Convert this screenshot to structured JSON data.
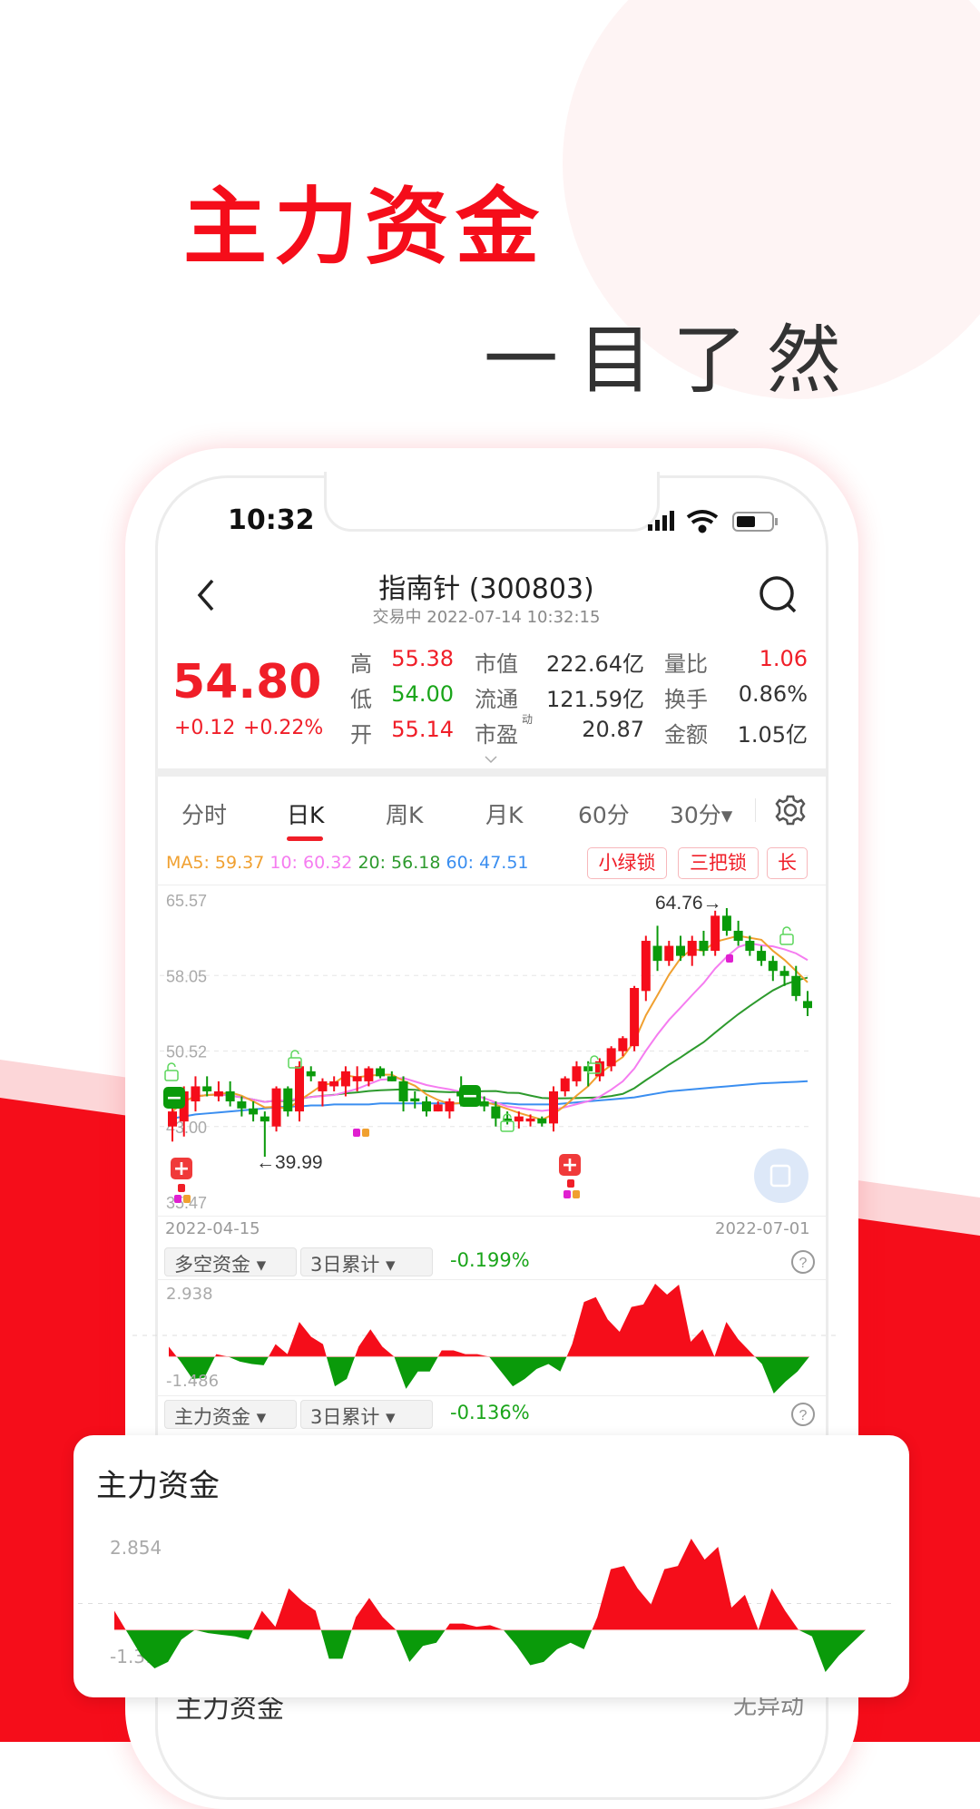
{
  "hero": {
    "title": "主力资金",
    "subtitle": "一目了然"
  },
  "colors": {
    "brand_red": "#f50d1a",
    "up": "#f50d1a",
    "down": "#0a9a0a",
    "ma5": "#f0a030",
    "ma10": "#f57cf0",
    "ma20": "#2d9a2d",
    "ma60": "#3a8ef0"
  },
  "status_bar": {
    "time": "10:32",
    "icons": [
      "signal-icon",
      "wifi-icon",
      "battery-icon"
    ]
  },
  "header": {
    "title": "指南针 (300803)",
    "subtitle": "交易中 2022-07-14 10:32:15"
  },
  "quote": {
    "price": "54.80",
    "change": "+0.12",
    "change_pct": "+0.22%",
    "stats": [
      [
        {
          "label": "高",
          "value": "55.38",
          "tone": "red"
        },
        {
          "label": "市值",
          "value": "222.64亿"
        },
        {
          "label": "量比",
          "value": "1.06",
          "tone": "red"
        }
      ],
      [
        {
          "label": "低",
          "value": "54.00",
          "tone": "green"
        },
        {
          "label": "流通",
          "value": "121.59亿"
        },
        {
          "label": "换手",
          "value": "0.86%"
        }
      ],
      [
        {
          "label": "开",
          "value": "55.14",
          "tone": "red"
        },
        {
          "label": "市盈",
          "sup": "动",
          "value": "20.87"
        },
        {
          "label": "金额",
          "value": "1.05亿"
        }
      ]
    ]
  },
  "tabs": [
    {
      "label": "分时"
    },
    {
      "label": "日K",
      "active": true
    },
    {
      "label": "周K"
    },
    {
      "label": "月K"
    },
    {
      "label": "60分"
    },
    {
      "label": "30分▾"
    }
  ],
  "ma": {
    "ma5": "MA5: 59.37",
    "ma10": "10: 60.32",
    "ma20": "20: 56.18",
    "ma60": "60: 47.51"
  },
  "tags": [
    "小绿锁",
    "三把锁",
    "长"
  ],
  "chart_data": [
    {
      "type": "candlestick",
      "y_ticks": [
        "65.57",
        "58.05",
        "50.52",
        "43.00",
        "35.47"
      ],
      "ylim": [
        35.47,
        65.57
      ],
      "x_labels": [
        "2022-04-15",
        "2022-07-01"
      ],
      "annotations": {
        "high": "64.76→",
        "low": "←39.99"
      },
      "ohlc": [
        [
          43.0,
          45.0,
          41.5,
          44.5
        ],
        [
          43.5,
          47.0,
          42.0,
          46.5
        ],
        [
          45.5,
          48.0,
          44.5,
          47.0
        ],
        [
          47.0,
          48.0,
          46.0,
          46.5
        ],
        [
          46.0,
          47.5,
          45.5,
          46.5
        ],
        [
          46.5,
          47.5,
          45.0,
          45.5
        ],
        [
          45.5,
          46.0,
          44.0,
          44.8
        ],
        [
          44.8,
          45.5,
          43.5,
          44.2
        ],
        [
          44.0,
          44.5,
          39.99,
          43.5
        ],
        [
          43.0,
          47.0,
          42.5,
          46.8
        ],
        [
          46.8,
          47.0,
          44.0,
          44.5
        ],
        [
          44.5,
          49.5,
          43.5,
          49.0
        ],
        [
          48.5,
          49.0,
          47.5,
          48.0
        ],
        [
          46.5,
          47.8,
          45.0,
          47.5
        ],
        [
          47.0,
          48.0,
          46.5,
          47.5
        ],
        [
          47.0,
          49.0,
          46.0,
          48.5
        ],
        [
          47.5,
          49.0,
          46.5,
          48.0
        ],
        [
          47.5,
          49.0,
          47.0,
          48.8
        ],
        [
          48.8,
          49.0,
          47.8,
          48.0
        ],
        [
          48.0,
          48.5,
          47.5,
          47.5
        ],
        [
          47.5,
          48.0,
          44.5,
          45.5
        ],
        [
          45.8,
          46.5,
          44.8,
          45.5
        ],
        [
          45.5,
          46.0,
          44.0,
          44.5
        ],
        [
          44.5,
          45.5,
          44.5,
          45.2
        ],
        [
          44.5,
          45.8,
          43.8,
          45.5
        ],
        [
          46.5,
          48.0,
          45.0,
          46.0
        ],
        [
          46.0,
          46.5,
          45.0,
          45.5
        ],
        [
          45.5,
          46.0,
          44.5,
          45.0
        ],
        [
          45.0,
          45.5,
          43.0,
          43.8
        ],
        [
          43.8,
          44.5,
          43.2,
          43.5
        ],
        [
          43.5,
          44.5,
          42.8,
          44.0
        ],
        [
          43.5,
          44.2,
          43.0,
          43.8
        ],
        [
          43.8,
          44.0,
          43.0,
          43.3
        ],
        [
          43.3,
          47.0,
          42.5,
          46.5
        ],
        [
          46.5,
          48.0,
          46.0,
          47.8
        ],
        [
          47.5,
          49.5,
          47.0,
          49.0
        ],
        [
          49.0,
          49.5,
          47.0,
          48.5
        ],
        [
          48.0,
          49.8,
          47.5,
          49.5
        ],
        [
          49.0,
          51.0,
          48.5,
          50.8
        ],
        [
          50.5,
          52.0,
          50.0,
          51.8
        ],
        [
          51.0,
          57.0,
          50.5,
          56.8
        ],
        [
          56.5,
          62.0,
          55.5,
          61.5
        ],
        [
          61.0,
          63.0,
          58.5,
          59.5
        ],
        [
          59.5,
          61.5,
          59.0,
          61.0
        ],
        [
          61.0,
          62.0,
          59.5,
          60.0
        ],
        [
          60.0,
          62.0,
          59.0,
          61.5
        ],
        [
          61.5,
          62.5,
          60.0,
          60.5
        ],
        [
          60.5,
          64.5,
          60.0,
          64.0
        ],
        [
          64.0,
          64.76,
          62.0,
          62.5
        ],
        [
          62.5,
          63.5,
          61.0,
          61.5
        ],
        [
          61.5,
          62.0,
          60.0,
          60.5
        ],
        [
          60.5,
          61.0,
          59.0,
          59.5
        ],
        [
          59.5,
          60.0,
          57.5,
          58.5
        ],
        [
          58.5,
          59.0,
          57.0,
          58.0
        ],
        [
          58.0,
          59.0,
          55.5,
          56.0
        ],
        [
          55.5,
          56.5,
          54.0,
          54.8
        ]
      ],
      "ma60": [
        43.8,
        44.0,
        44.2,
        44.3,
        44.4,
        44.5,
        44.6,
        44.7,
        44.8,
        44.9,
        45.0,
        45.0,
        45.1,
        45.1,
        45.2,
        45.2,
        45.2,
        45.2,
        45.3,
        45.3,
        45.3,
        45.3,
        45.3,
        45.3,
        45.3,
        45.3,
        45.3,
        45.3,
        45.3,
        45.3,
        45.2,
        45.2,
        45.2,
        45.2,
        45.3,
        45.4,
        45.5,
        45.6,
        45.7,
        45.8,
        45.9,
        46.1,
        46.3,
        46.5,
        46.6,
        46.7,
        46.8,
        46.9,
        47.0,
        47.1,
        47.2,
        47.3,
        47.35,
        47.4,
        47.45,
        47.51
      ]
    },
    {
      "type": "area",
      "indicator": "多空资金",
      "period": "3日累计",
      "value": "-0.199%",
      "y_ticks": [
        "2.938",
        "-1.486"
      ],
      "ylim": [
        -1.486,
        2.938
      ],
      "values": [
        0.4,
        -0.2,
        -0.9,
        -0.85,
        0.1,
        0,
        -0.2,
        -0.3,
        -0.35,
        0.5,
        0.1,
        1.4,
        0.8,
        0.5,
        -1.2,
        -0.9,
        0.4,
        1.1,
        0.4,
        0,
        -1.3,
        -0.6,
        -0.6,
        0.25,
        0.25,
        0.1,
        0.1,
        0,
        -0.6,
        -1.2,
        -0.9,
        -0.5,
        -0.3,
        -0.6,
        0.5,
        2.2,
        2.4,
        1.5,
        1.0,
        2.0,
        2.1,
        2.938,
        2.5,
        2.9,
        0.6,
        1.1,
        0,
        1.4,
        0.7,
        0.2,
        -0.3,
        -1.486,
        -1.0,
        -0.6,
        0
      ]
    },
    {
      "type": "area",
      "indicator": "主力资金",
      "period": "3日累计",
      "value": "-0.136%"
    },
    {
      "type": "area",
      "title": "主力资金",
      "y_ticks": [
        "2.854",
        "-1.314"
      ],
      "ylim": [
        -1.314,
        2.854
      ],
      "values": [
        0.6,
        -0.1,
        -0.8,
        -1.2,
        -1.0,
        -0.3,
        0,
        -0.1,
        -0.15,
        -0.2,
        -0.3,
        0.6,
        0.1,
        1.3,
        0.9,
        0.6,
        -0.9,
        -0.9,
        0.4,
        1.0,
        0.4,
        0,
        -1.0,
        -0.5,
        -0.4,
        0.2,
        0.2,
        0.1,
        0.15,
        0,
        -0.5,
        -1.1,
        -1.0,
        -0.6,
        -0.4,
        -0.6,
        0.4,
        1.9,
        2.0,
        1.3,
        0.8,
        1.9,
        2.0,
        2.854,
        2.2,
        2.6,
        0.7,
        1.1,
        0,
        1.3,
        0.6,
        0,
        -0.2,
        -1.314,
        -0.8,
        -0.4,
        0
      ]
    }
  ],
  "below_card": {
    "label": "主力资金",
    "status": "无异动"
  }
}
